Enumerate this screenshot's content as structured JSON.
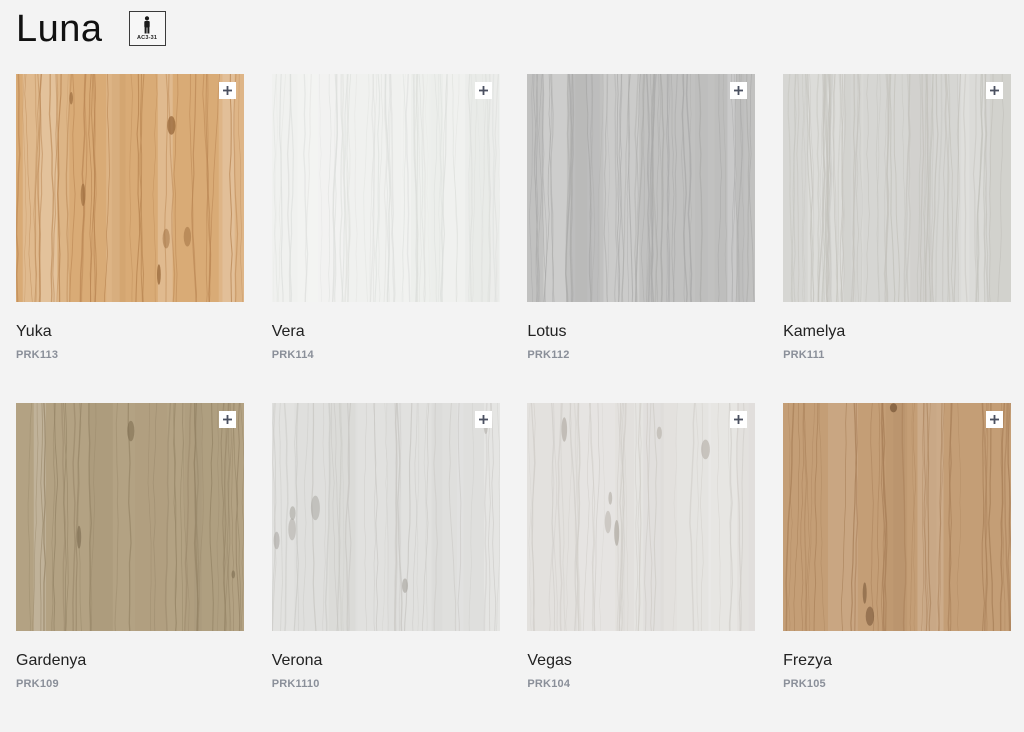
{
  "page": {
    "title": "Luna",
    "badge": {
      "label": "AC3-31",
      "icon": "person-icon"
    }
  },
  "products": [
    {
      "name": "Yuka",
      "code": "PRK113",
      "base": "#d9ab76",
      "grain": "#b78350",
      "knot": "#9a6a3c",
      "style": "knotty"
    },
    {
      "name": "Vera",
      "code": "PRK114",
      "base": "#f0f1ef",
      "grain": "#dcdedb",
      "knot": "#d2d4d1",
      "style": "fine"
    },
    {
      "name": "Lotus",
      "code": "PRK112",
      "base": "#c1c1c0",
      "grain": "#a9a9a8",
      "knot": "#9c9c9b",
      "style": "fine"
    },
    {
      "name": "Kamelya",
      "code": "PRK111",
      "base": "#d6d6d3",
      "grain": "#c2c1bb",
      "knot": "#bdb6aa",
      "style": "streak"
    },
    {
      "name": "Gardenya",
      "code": "PRK109",
      "base": "#b3a283",
      "grain": "#958466",
      "knot": "#7e6e52",
      "style": "plank"
    },
    {
      "name": "Verona",
      "code": "PRK1110",
      "base": "#dfdfdd",
      "grain": "#c8c7c3",
      "knot": "#a9a6a0",
      "style": "knotty"
    },
    {
      "name": "Vegas",
      "code": "PRK104",
      "base": "#e3e1de",
      "grain": "#cfccc7",
      "knot": "#b3aea6",
      "style": "knotty"
    },
    {
      "name": "Frezya",
      "code": "PRK105",
      "base": "#c49e76",
      "grain": "#a87f58",
      "knot": "#7c5a3b",
      "style": "plank"
    }
  ]
}
